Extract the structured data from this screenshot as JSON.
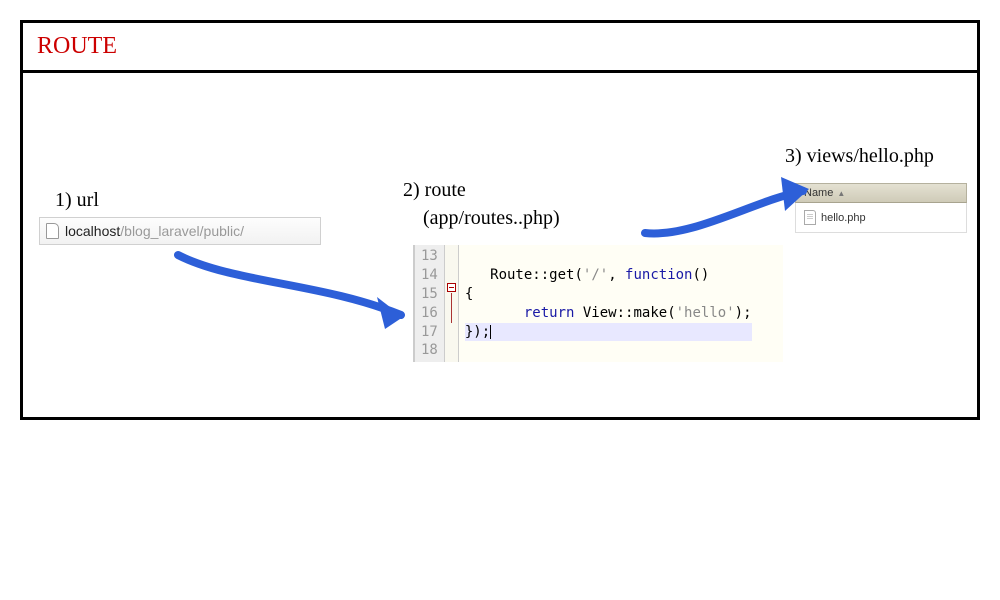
{
  "title": "ROUTE",
  "steps": {
    "s1": {
      "label": "1) url"
    },
    "s2": {
      "label": "2) route",
      "sub": "(app/routes..php)"
    },
    "s3": {
      "label": "3) views/hello.php"
    }
  },
  "addressbar": {
    "host": "localhost",
    "path": "/blog_laravel/public/"
  },
  "code": {
    "lines": [
      {
        "num": "13",
        "html": ""
      },
      {
        "num": "14",
        "html": "   Route::get('/', function()"
      },
      {
        "num": "15",
        "html": "{"
      },
      {
        "num": "16",
        "html": "       return View::make('hello');"
      },
      {
        "num": "17",
        "html": "});"
      },
      {
        "num": "18",
        "html": ""
      }
    ]
  },
  "explorer": {
    "column_header": "Name",
    "file": "hello.php"
  }
}
